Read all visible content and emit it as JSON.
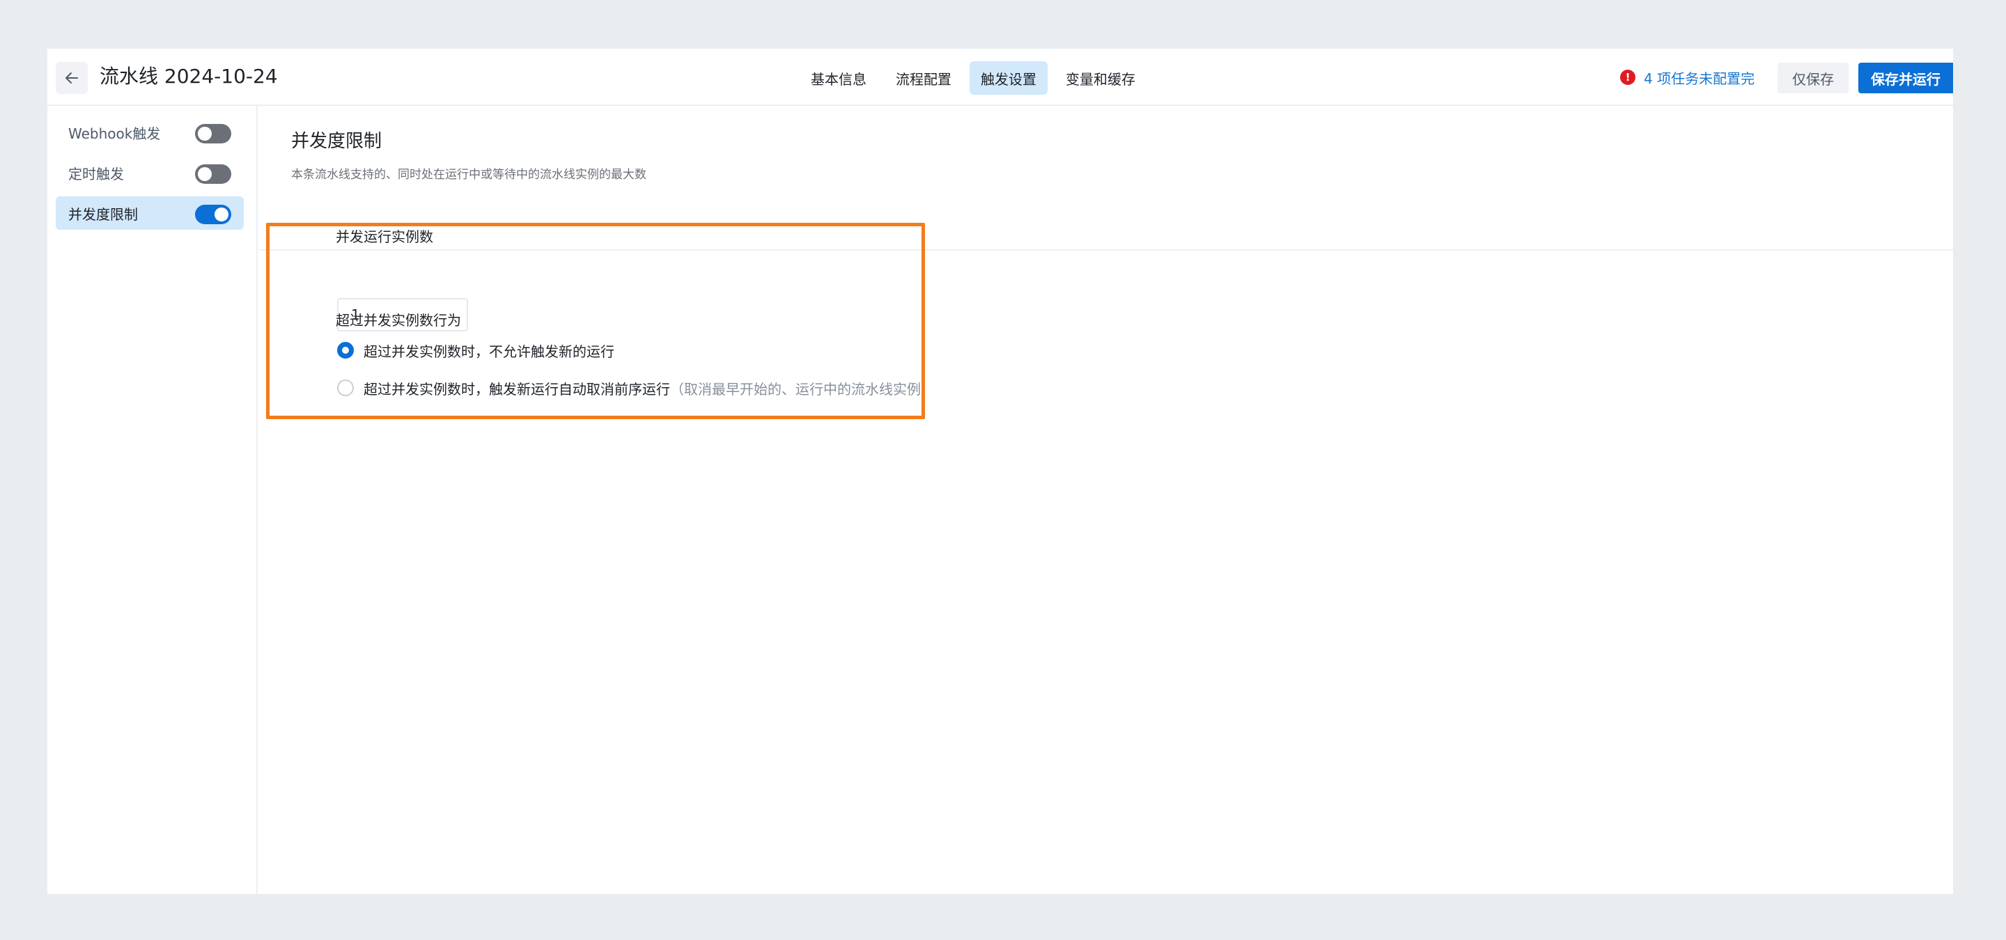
{
  "header": {
    "title": "流水线 2024-10-24",
    "tabs": [
      {
        "label": "基本信息",
        "active": false
      },
      {
        "label": "流程配置",
        "active": false
      },
      {
        "label": "触发设置",
        "active": true
      },
      {
        "label": "变量和缓存",
        "active": false
      }
    ],
    "warning_text": "4 项任务未配置完",
    "warning_icon": "alert-icon",
    "save_only_label": "仅保存",
    "save_run_label": "保存并运行"
  },
  "sidebar": {
    "items": [
      {
        "label": "Webhook触发",
        "enabled": false,
        "active": false
      },
      {
        "label": "定时触发",
        "enabled": false,
        "active": false
      },
      {
        "label": "并发度限制",
        "enabled": true,
        "active": true
      }
    ]
  },
  "main": {
    "title": "并发度限制",
    "description": "本条流水线支持的、同时处在运行中或等待中的流水线实例的最大数",
    "concurrency_label": "并发运行实例数",
    "concurrency_value": "1",
    "behavior_label": "超过并发实例数行为",
    "options": [
      {
        "text": "超过并发实例数时，不允许触发新的运行",
        "hint": "",
        "checked": true
      },
      {
        "text": "超过并发实例数时，触发新运行自动取消前序运行",
        "hint": "（取消最早开始的、运行中的流水线实例）",
        "checked": false
      }
    ]
  },
  "colors": {
    "accent": "#0b6fd6",
    "highlight_border": "#f37c1b",
    "warning": "#e01b24",
    "active_tab_bg": "#d2e8fb"
  }
}
